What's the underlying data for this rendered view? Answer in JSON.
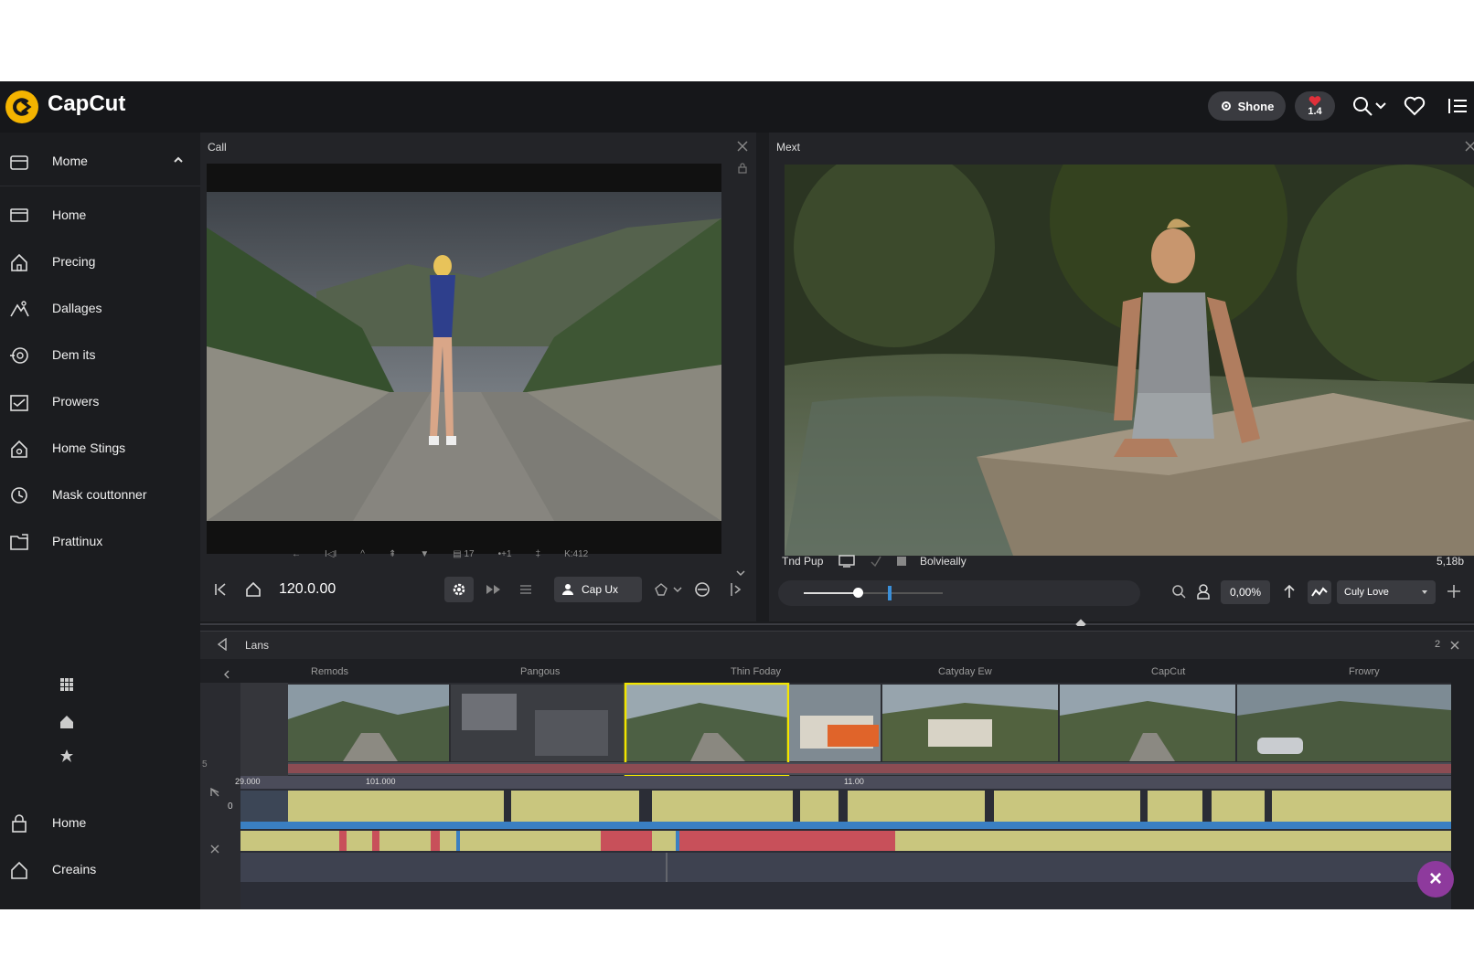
{
  "app": {
    "name": "CapCut"
  },
  "topbar": {
    "shone_label": "Shone",
    "heart_badge": "1.4",
    "icons": [
      "search-icon",
      "chevron-down-icon",
      "heart-icon",
      "list-icon"
    ]
  },
  "sidebar": {
    "header_label": "Mome",
    "items": [
      {
        "label": "Home",
        "icon": "monitor-icon"
      },
      {
        "label": "Precing",
        "icon": "home-icon"
      },
      {
        "label": "Dallages",
        "icon": "mountain-icon"
      },
      {
        "label": "Dem its",
        "icon": "target-icon"
      },
      {
        "label": "Prowers",
        "icon": "calendar-icon"
      },
      {
        "label": "Home Stings",
        "icon": "house-settings-icon"
      },
      {
        "label": "Mask couttonner",
        "icon": "clock-icon"
      },
      {
        "label": "Prattinux",
        "icon": "folder-icon"
      }
    ],
    "bottom_items": [
      {
        "label": "Home",
        "icon": "lock-icon"
      },
      {
        "label": "Creains",
        "icon": "home-icon"
      }
    ]
  },
  "left_panel": {
    "title": "Call",
    "tool_strip": [
      "←",
      "I◁I",
      "^",
      "⇞",
      "▼",
      "▤ 17",
      "•+1",
      "‡",
      "K:412"
    ],
    "timecode": "120.0.00",
    "cap_button": "Cap Ux"
  },
  "right_panel": {
    "title": "Mext",
    "track_label": "Tnd Pup",
    "effect_label": "Bolvieally",
    "duration": "5,18b",
    "percent": "0,00%",
    "dropdown_value": "Culy Love"
  },
  "timeline": {
    "title": "Lans",
    "count": "2",
    "clip_labels": [
      "Remods",
      "Pangous",
      "Thin Foday",
      "Catyday Ew",
      "CapCut",
      "Frowry"
    ],
    "ruler_labels": [
      "29.000",
      "101.000",
      "11.00"
    ],
    "track_marker": "0",
    "strip_marker": "5"
  },
  "colors": {
    "accent_logo": "#f4b400",
    "selection": "#f2e500",
    "waveform": "#c9c67e",
    "audio_red": "#c8505a",
    "fab": "#8e3a9d"
  }
}
